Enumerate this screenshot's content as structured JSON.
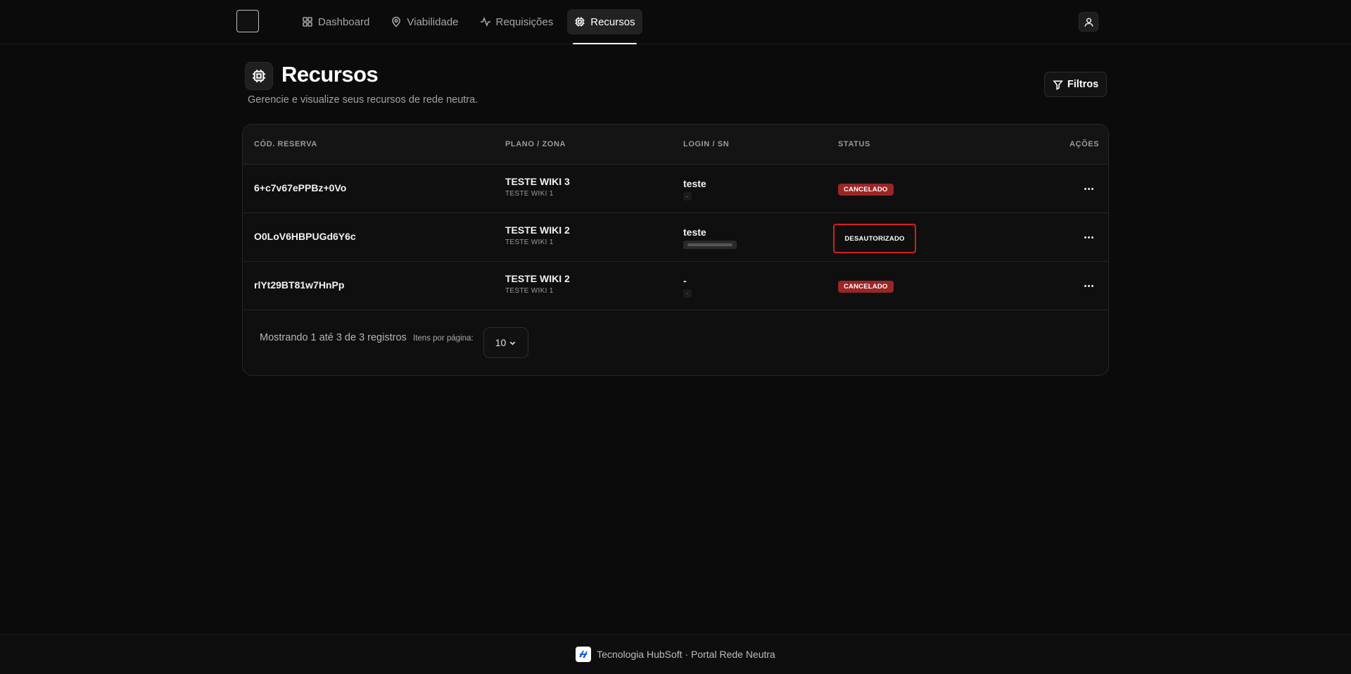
{
  "nav": {
    "items": [
      {
        "label": "Dashboard",
        "icon": "grid-icon",
        "active": false
      },
      {
        "label": "Viabilidade",
        "icon": "map-pin-icon",
        "active": false
      },
      {
        "label": "Requisições",
        "icon": "activity-icon",
        "active": false
      },
      {
        "label": "Recursos",
        "icon": "cpu-icon",
        "active": true
      }
    ]
  },
  "header": {
    "title": "Recursos",
    "subtitle": "Gerencie e visualize seus recursos de rede neutra.",
    "filters_label": "Filtros"
  },
  "table": {
    "columns": [
      "CÓD. RESERVA",
      "PLANO / ZONA",
      "LOGIN / SN",
      "STATUS",
      "AÇÕES"
    ],
    "rows": [
      {
        "code": "6+c7v67ePPBz+0Vo",
        "plan": "TESTE WIKI 3",
        "zone": "TESTE WIKI 1",
        "login": "teste",
        "sn": "-",
        "status": "CANCELADO"
      },
      {
        "code": "O0LoV6HBPUGd6Y6c",
        "plan": "TESTE WIKI 2",
        "zone": "TESTE WIKI 1",
        "login": "teste",
        "sn": "",
        "status": "DESAUTORIZADO"
      },
      {
        "code": "rlYt29BT81w7HnPp",
        "plan": "TESTE WIKI 2",
        "zone": "TESTE WIKI 1",
        "login": "-",
        "sn": "-",
        "status": "CANCELADO"
      }
    ]
  },
  "pagination": {
    "summary": "Mostrando 1 até 3 de 3 registros",
    "per_page_label": "Itens por página:",
    "per_page_value": "10"
  },
  "footer": {
    "text": "Tecnologia HubSoft · Portal Rede Neutra"
  },
  "colors": {
    "background": "#0b0b0b",
    "badge_cancelado": "#9b2626",
    "highlight_border": "#d61f1f"
  }
}
